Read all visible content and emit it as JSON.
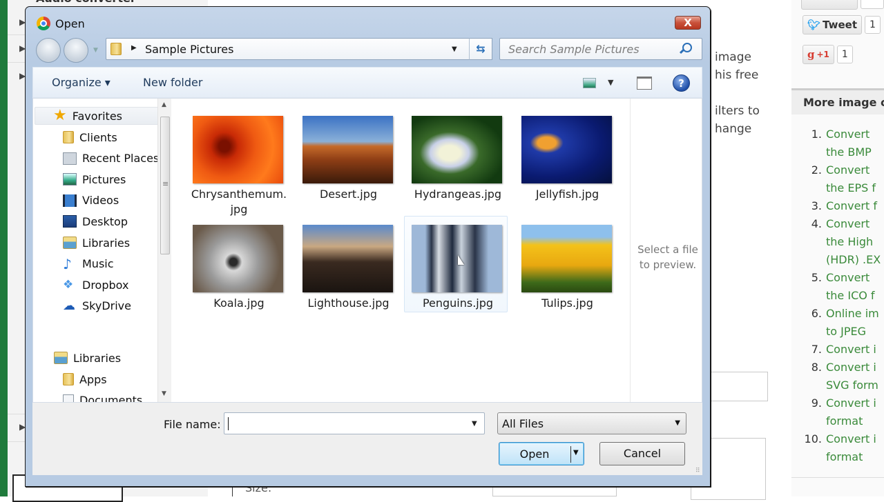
{
  "background": {
    "section_title": "Audio converter",
    "paragraph_fragments": [
      "image",
      "his free",
      "ilters to",
      "hange"
    ],
    "size_label": "Size:",
    "social": {
      "tweet_label": "Tweet",
      "tweet_count": "1",
      "gplus_label": "+1",
      "gplus_count": "1"
    },
    "more_header": "More image c",
    "more_items": [
      {
        "num": "1.",
        "lines": [
          "Convert",
          "the BMP"
        ]
      },
      {
        "num": "2.",
        "lines": [
          "Convert",
          "the EPS f"
        ]
      },
      {
        "num": "3.",
        "lines": [
          "Convert f"
        ]
      },
      {
        "num": "4.",
        "lines": [
          "Convert",
          "the High",
          "(HDR) .EX"
        ]
      },
      {
        "num": "5.",
        "lines": [
          "Convert",
          "the ICO f"
        ]
      },
      {
        "num": "6.",
        "lines": [
          "Online im",
          "to JPEG"
        ]
      },
      {
        "num": "7.",
        "lines": [
          "Convert i"
        ]
      },
      {
        "num": "8.",
        "lines": [
          "Convert i",
          "SVG form"
        ]
      },
      {
        "num": "9.",
        "lines": [
          "Convert i",
          "format"
        ]
      },
      {
        "num": "10.",
        "lines": [
          "Convert i",
          "format"
        ]
      }
    ],
    "link_color": "#3a8a3a"
  },
  "dialog": {
    "title": "Open",
    "close_label": "X",
    "address": {
      "path": "Sample Pictures"
    },
    "search": {
      "placeholder": "Search Sample Pictures",
      "value": ""
    },
    "toolbar": {
      "organize": "Organize ▾",
      "new_folder": "New folder",
      "help": "?"
    },
    "nav": {
      "favorites_label": "Favorites",
      "favorites": [
        {
          "label": "Clients",
          "icon": "folder-icon"
        },
        {
          "label": "Recent Places",
          "icon": "recent-places-icon"
        },
        {
          "label": "Pictures",
          "icon": "pictures-icon"
        },
        {
          "label": "Videos",
          "icon": "videos-icon"
        },
        {
          "label": "Desktop",
          "icon": "desktop-icon"
        },
        {
          "label": "Libraries",
          "icon": "libraries-icon"
        },
        {
          "label": "Music",
          "icon": "music-icon"
        },
        {
          "label": "Dropbox",
          "icon": "dropbox-icon"
        },
        {
          "label": "SkyDrive",
          "icon": "skydrive-icon"
        }
      ],
      "libraries_label": "Libraries",
      "libraries": [
        {
          "label": "Apps",
          "icon": "folder-icon"
        },
        {
          "label": "Documents",
          "icon": "documents-icon"
        }
      ]
    },
    "files": [
      {
        "name": "Chrysanthemum.jpg",
        "name_lines": [
          "Chrysanthemum.",
          "jpg"
        ],
        "thumb": "chrysanthemum"
      },
      {
        "name": "Desert.jpg",
        "name_lines": [
          "Desert.jpg"
        ],
        "thumb": "desert"
      },
      {
        "name": "Hydrangeas.jpg",
        "name_lines": [
          "Hydrangeas.jpg"
        ],
        "thumb": "hydrangeas"
      },
      {
        "name": "Jellyfish.jpg",
        "name_lines": [
          "Jellyfish.jpg"
        ],
        "thumb": "jellyfish"
      },
      {
        "name": "Koala.jpg",
        "name_lines": [
          "Koala.jpg"
        ],
        "thumb": "koala"
      },
      {
        "name": "Lighthouse.jpg",
        "name_lines": [
          "Lighthouse.jpg"
        ],
        "thumb": "lighthouse"
      },
      {
        "name": "Penguins.jpg",
        "name_lines": [
          "Penguins.jpg"
        ],
        "thumb": "penguins",
        "hovered": true
      },
      {
        "name": "Tulips.jpg",
        "name_lines": [
          "Tulips.jpg"
        ],
        "thumb": "tulips"
      }
    ],
    "preview_text": "Select a file to preview.",
    "footer": {
      "file_name_label": "File name:",
      "file_name_value": "",
      "file_type": "All Files",
      "open_label": "Open",
      "cancel_label": "Cancel"
    }
  }
}
